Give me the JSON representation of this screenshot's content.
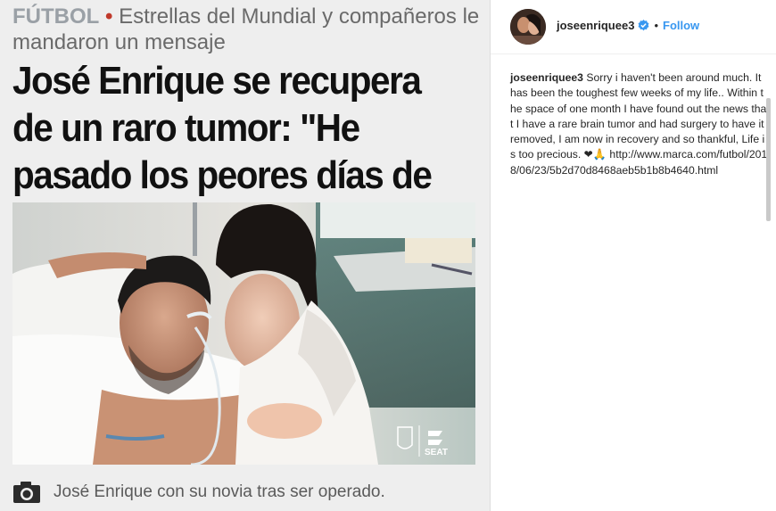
{
  "article": {
    "section": "FÚTBOL",
    "bullet": "•",
    "kicker_text": "Estrellas del Mundial y compañeros le mandaron un mensaje",
    "headline": "José Enrique se recupera de un raro tumor: \"He pasado los peores días de mi vida\"",
    "photo_badge_text": "SEAT",
    "caption": "José Enrique con su novia tras ser operado.",
    "caption_icon": "camera-icon"
  },
  "instagram": {
    "username": "joseenriquee3",
    "verified_icon": "verified-badge-icon",
    "separator": "•",
    "follow_label": "Follow",
    "caption_author": "joseenriquee3",
    "caption_text": "Sorry i haven't been around much. It has been the toughest few weeks of my life.. Within the space of one month I have found out the news that I have a rare brain tumor and had surgery to have it removed, I am now in recovery and so thankful, Life is too precious. ❤🙏 http://www.marca.com/futbol/2018/06/23/5b2d70d8468aeb5b1b8b4640.html"
  },
  "colors": {
    "article_bg": "#eeeeee",
    "headline": "#111111",
    "kicker": "#6a6a6a",
    "section_gray": "#9aa0a6",
    "bullet_red": "#c0392b",
    "follow_blue": "#3897f0",
    "insta_text": "#262626"
  }
}
